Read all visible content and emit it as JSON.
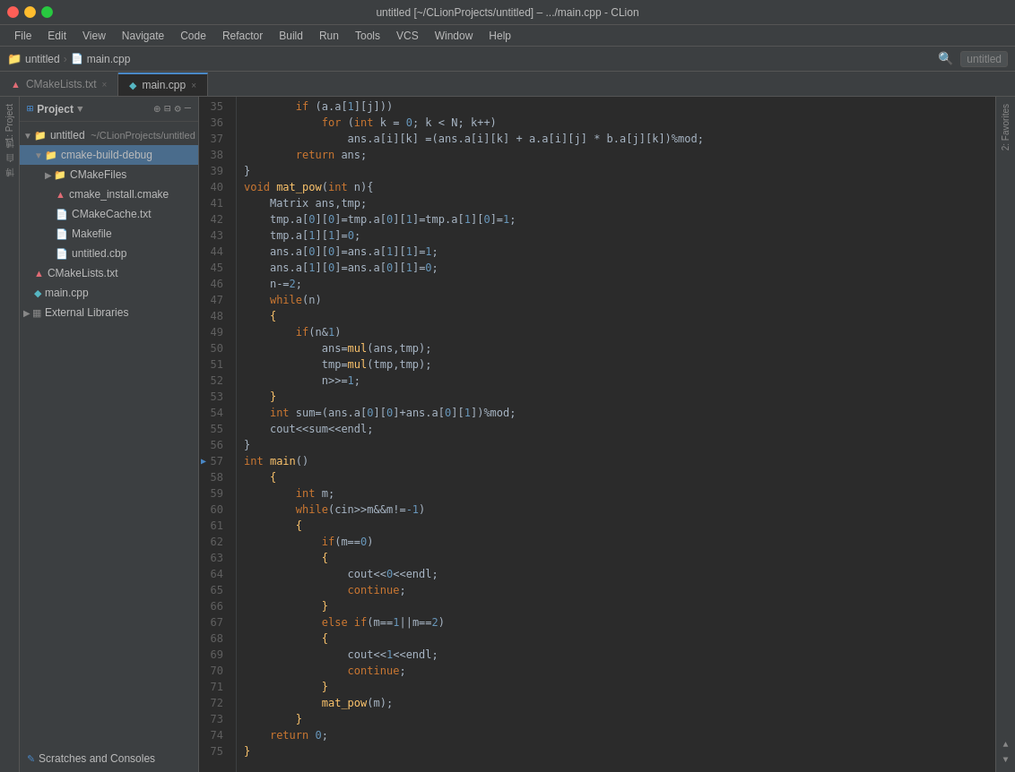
{
  "titleBar": {
    "title": "untitled [~/CLionProjects/untitled] – .../main.cpp - CLion"
  },
  "menuBar": {
    "items": [
      "File",
      "Edit",
      "View",
      "Navigate",
      "Code",
      "Refactor",
      "Build",
      "Run",
      "Tools",
      "VCS",
      "Window",
      "Help"
    ]
  },
  "navBar": {
    "breadcrumb": [
      "untitled",
      "main.cpp"
    ],
    "rightLabel": "untitled"
  },
  "tabs": {
    "list": [
      {
        "label": "CMakeLists.txt",
        "type": "cmake",
        "active": false,
        "closeable": true
      },
      {
        "label": "main.cpp",
        "type": "cpp",
        "active": true,
        "closeable": true
      }
    ]
  },
  "sidebar": {
    "title": "Project",
    "icons": [
      "+",
      "⊟",
      "⚙",
      "—"
    ],
    "tree": [
      {
        "indent": 0,
        "label": "untitled  ~/CLionProjects/untitled",
        "type": "project",
        "arrow": "▼",
        "selected": false
      },
      {
        "indent": 1,
        "label": "cmake-build-debug",
        "type": "folder",
        "arrow": "▼",
        "selected": true
      },
      {
        "indent": 2,
        "label": "CMakeFiles",
        "type": "folder",
        "arrow": "▶",
        "selected": false
      },
      {
        "indent": 3,
        "label": "cmake_install.cmake",
        "type": "cmake",
        "arrow": "",
        "selected": false
      },
      {
        "indent": 3,
        "label": "CMakeCache.txt",
        "type": "file",
        "arrow": "",
        "selected": false
      },
      {
        "indent": 3,
        "label": "Makefile",
        "type": "file",
        "arrow": "",
        "selected": false
      },
      {
        "indent": 3,
        "label": "untitled.cbp",
        "type": "file",
        "arrow": "",
        "selected": false
      },
      {
        "indent": 1,
        "label": "CMakeLists.txt",
        "type": "cmake",
        "arrow": "",
        "selected": false
      },
      {
        "indent": 1,
        "label": "main.cpp",
        "type": "cpp",
        "arrow": "",
        "selected": false
      },
      {
        "indent": 0,
        "label": "External Libraries",
        "type": "folder",
        "arrow": "▶",
        "selected": false
      }
    ],
    "bottomItems": [
      {
        "label": "Scratches and Consoles",
        "type": "scratch"
      }
    ]
  },
  "editor": {
    "lines": [
      {
        "num": 35,
        "content": "    if (a.a[1][j])"
      },
      {
        "num": 36,
        "content": "        for (int k = 0; k < N; k++)"
      },
      {
        "num": 37,
        "content": "            ans.a[i][k] =(ans.a[i][k] + a.a[i][j] * b.a[j][k])%mod;"
      },
      {
        "num": 38,
        "content": "    return ans;"
      },
      {
        "num": 39,
        "content": "}"
      },
      {
        "num": 40,
        "content": "void mat_pow(int n){"
      },
      {
        "num": 41,
        "content": "    Matrix ans,tmp;"
      },
      {
        "num": 42,
        "content": "    tmp.a[0][0]=tmp.a[0][1]=tmp.a[1][0]=1;"
      },
      {
        "num": 43,
        "content": "    tmp.a[1][1]=0;"
      },
      {
        "num": 44,
        "content": "    ans.a[0][0]=ans.a[1][1]=1;"
      },
      {
        "num": 45,
        "content": "    ans.a[1][0]=ans.a[0][1]=0;"
      },
      {
        "num": 46,
        "content": "    n-=2;"
      },
      {
        "num": 47,
        "content": "    while(n)"
      },
      {
        "num": 48,
        "content": "    {"
      },
      {
        "num": 49,
        "content": "        if(n&1)"
      },
      {
        "num": 50,
        "content": "            ans=mul(ans,tmp);"
      },
      {
        "num": 51,
        "content": "            tmp=mul(tmp,tmp);"
      },
      {
        "num": 52,
        "content": "            n>>=1;"
      },
      {
        "num": 53,
        "content": "    }"
      },
      {
        "num": 54,
        "content": "    int sum=(ans.a[0][0]+ans.a[0][1])%mod;"
      },
      {
        "num": 55,
        "content": "    cout<<sum<<endl;"
      },
      {
        "num": 56,
        "content": "}"
      },
      {
        "num": 57,
        "content": "int main()",
        "hasRunArrow": true
      },
      {
        "num": 58,
        "content": "    {"
      },
      {
        "num": 59,
        "content": "        int m;"
      },
      {
        "num": 60,
        "content": "        while(cin>>m&&m!=-1)"
      },
      {
        "num": 61,
        "content": "        {"
      },
      {
        "num": 62,
        "content": "            if(m==0)"
      },
      {
        "num": 63,
        "content": "            {"
      },
      {
        "num": 64,
        "content": "                cout<<0<<endl;"
      },
      {
        "num": 65,
        "content": "                continue;"
      },
      {
        "num": 66,
        "content": "            }"
      },
      {
        "num": 67,
        "content": "            else if(m==1||m==2)"
      },
      {
        "num": 68,
        "content": "            {"
      },
      {
        "num": 69,
        "content": "                cout<<1<<endl;"
      },
      {
        "num": 70,
        "content": "                continue;"
      },
      {
        "num": 71,
        "content": "            }"
      },
      {
        "num": 72,
        "content": "            mat_pow(m);"
      },
      {
        "num": 73,
        "content": "        }"
      },
      {
        "num": 74,
        "content": "    return 0;"
      },
      {
        "num": 75,
        "content": "}"
      }
    ]
  },
  "leftMarginTabs": [
    {
      "label": "1: Project"
    },
    {
      "label": "博"
    },
    {
      "label": "自"
    },
    {
      "label": "博"
    }
  ],
  "rightMarginTabs": [
    {
      "label": "2: Favorites"
    }
  ]
}
